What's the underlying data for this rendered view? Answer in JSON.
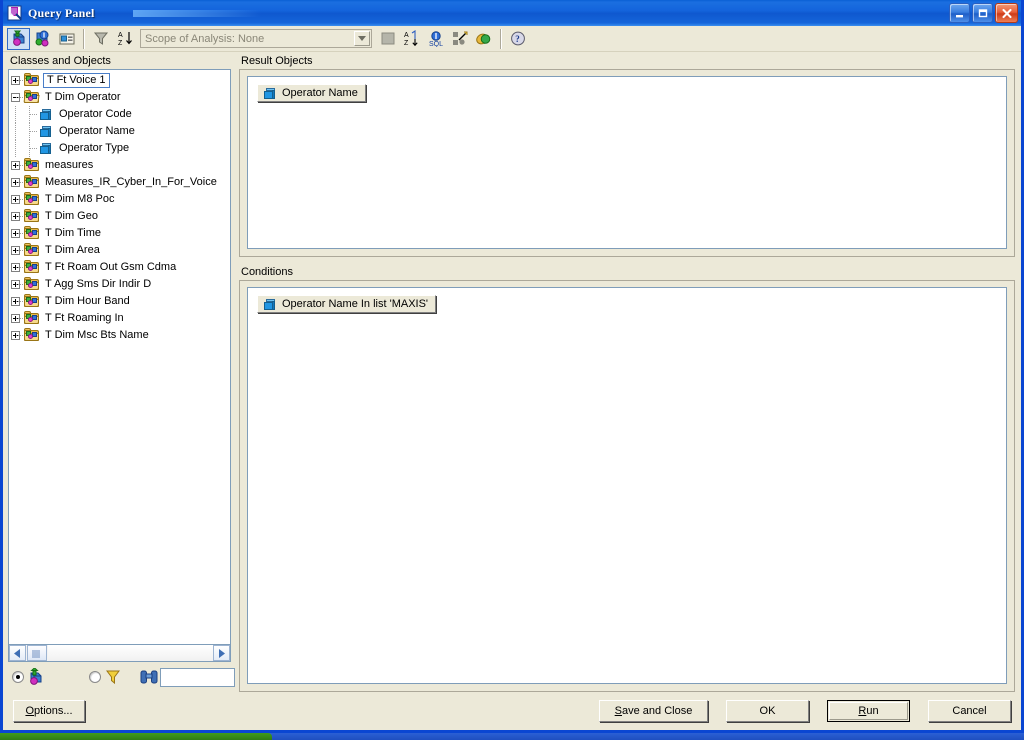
{
  "window": {
    "title": "Query Panel",
    "icon": "query-panel-icon",
    "buttons": {
      "minimize": "minimize-button",
      "maximize": "maximize-button",
      "close": "close-button"
    }
  },
  "toolbar": {
    "buttons": [
      {
        "name": "view-objects-button",
        "icon": "objects-cube-icon",
        "pressed": true
      },
      {
        "name": "view-structure-button",
        "icon": "structure-icon",
        "pressed": false
      },
      {
        "name": "view-names-button",
        "icon": "names-card-icon",
        "pressed": false
      },
      {
        "name": "filter-button",
        "icon": "funnel-icon",
        "pressed": false
      },
      {
        "name": "sort-button",
        "icon": "sort-az-icon",
        "pressed": false
      }
    ],
    "scope": {
      "value": "Scope of Analysis: None",
      "placeholder": "Scope of Analysis: None"
    },
    "right_buttons": [
      {
        "name": "stop-button",
        "icon": "stop-square-icon"
      },
      {
        "name": "sort-descending-button",
        "icon": "sort-az-down-icon"
      },
      {
        "name": "view-sql-button",
        "icon": "sql-icon"
      },
      {
        "name": "scope-of-analysis-button",
        "icon": "scatter-blocks-icon"
      },
      {
        "name": "combined-query-button",
        "icon": "combined-query-icon"
      },
      {
        "name": "help-button",
        "icon": "help-question-icon"
      }
    ]
  },
  "left_panel": {
    "label": "Classes and Objects",
    "tree": [
      {
        "label": "T Ft Voice 1",
        "type": "class",
        "depth": 0,
        "state": "collapsed",
        "selected": true
      },
      {
        "label": "T Dim Operator",
        "type": "class",
        "depth": 0,
        "state": "expanded",
        "selected": false
      },
      {
        "label": "Operator Code",
        "type": "object",
        "depth": 1,
        "state": "leaf",
        "selected": false
      },
      {
        "label": "Operator Name",
        "type": "object",
        "depth": 1,
        "state": "leaf",
        "selected": false
      },
      {
        "label": "Operator Type",
        "type": "object",
        "depth": 1,
        "state": "leaf",
        "selected": false
      },
      {
        "label": "measures",
        "type": "class",
        "depth": 0,
        "state": "collapsed",
        "selected": false
      },
      {
        "label": "Measures_IR_Cyber_In_For_Voice",
        "type": "class",
        "depth": 0,
        "state": "collapsed",
        "selected": false
      },
      {
        "label": "T Dim M8 Poc",
        "type": "class",
        "depth": 0,
        "state": "collapsed",
        "selected": false
      },
      {
        "label": "T Dim Geo",
        "type": "class",
        "depth": 0,
        "state": "collapsed",
        "selected": false
      },
      {
        "label": "T Dim Time",
        "type": "class",
        "depth": 0,
        "state": "collapsed",
        "selected": false
      },
      {
        "label": "T Dim Area",
        "type": "class",
        "depth": 0,
        "state": "collapsed",
        "selected": false
      },
      {
        "label": "T Ft Roam Out Gsm Cdma",
        "type": "class",
        "depth": 0,
        "state": "collapsed",
        "selected": false
      },
      {
        "label": "T Agg Sms Dir Indir D",
        "type": "class",
        "depth": 0,
        "state": "collapsed",
        "selected": false
      },
      {
        "label": "T Dim Hour Band",
        "type": "class",
        "depth": 0,
        "state": "collapsed",
        "selected": false
      },
      {
        "label": "T Ft Roaming In",
        "type": "class",
        "depth": 0,
        "state": "collapsed",
        "selected": false
      },
      {
        "label": "T Dim Msc Bts Name",
        "type": "class",
        "depth": 0,
        "state": "collapsed",
        "selected": false
      }
    ],
    "view_mode": {
      "objects_selected": true,
      "filters_selected": false,
      "objects_icon": "objects-cube-icon",
      "filters_icon": "funnel-icon"
    },
    "find": {
      "icon": "binoculars-icon",
      "value": "",
      "placeholder": ""
    }
  },
  "result_objects": {
    "label": "Result Objects",
    "items": [
      {
        "label": "Operator Name",
        "icon": "object-cube-icon"
      }
    ]
  },
  "conditions": {
    "label": "Conditions",
    "items": [
      {
        "label": "Operator Name In list 'MAXIS'",
        "icon": "object-cube-icon"
      }
    ]
  },
  "footer": {
    "options_label": "Options...",
    "options_accel": "O",
    "save_and_close_label": "Save and Close",
    "save_and_close_accel": "S",
    "ok_label": "OK",
    "run_label": "Run",
    "run_accel": "R",
    "cancel_label": "Cancel"
  },
  "colors": {
    "title_bar": "#0f58cf",
    "window_face": "#ece9d8",
    "selection_border": "#4a7ec8",
    "field_border": "#7f9db9",
    "close_button": "#cd3b18",
    "taskbar": "#2b5fd4",
    "start_button": "#3f9b1c"
  }
}
